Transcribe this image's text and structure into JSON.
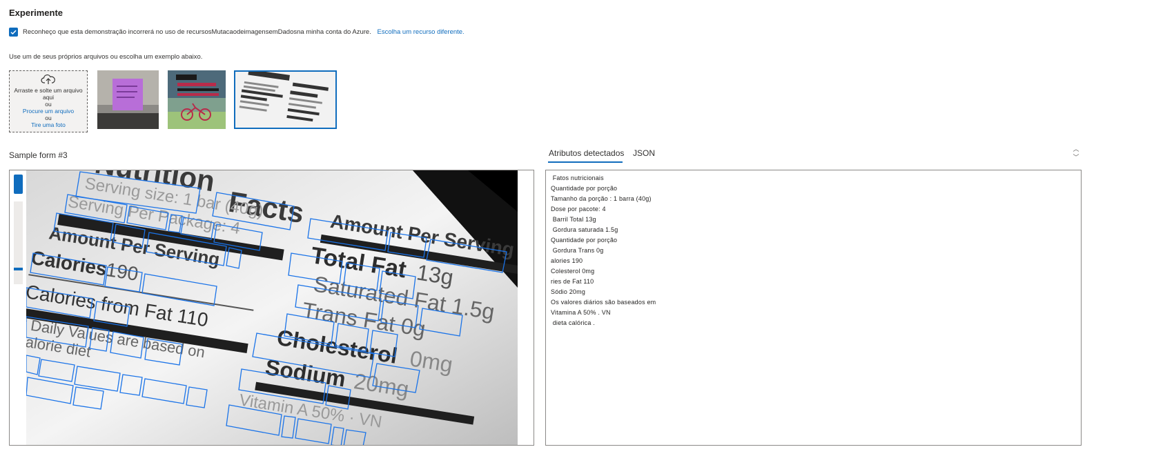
{
  "header": {
    "title": "Experimente"
  },
  "consent": {
    "checked": true,
    "text": "Reconheço que esta demonstração incorrerá no uso de recursosMutacaodeimagensemDadosna minha conta do Azure.",
    "link": "Escolha um recurso diferente."
  },
  "instructions": "Use um de seus próprios arquivos ou escolha um exemplo abaixo.",
  "upload": {
    "line1": "Arraste e solte um arquivo",
    "line2": "aqui",
    "or1": "ou",
    "browse": "Procure um arquivo",
    "or2": "ou",
    "photo": "Tire uma foto",
    "icon": "cloud-upload-icon"
  },
  "samples": [
    {
      "name": "sticky-note"
    },
    {
      "name": "life-is-like-poster"
    },
    {
      "name": "nutrition-facts",
      "selected": true
    }
  ],
  "sample_label": "Sample form #3",
  "tabs": {
    "active": "Atributos detectados",
    "json": "JSON"
  },
  "results": [
    " Fatos nutricionais",
    "Quantidade por porção",
    "Tamanho da porção : 1 barra (40g)",
    "Dose por pacote: 4",
    " Barril Total 13g",
    " Gordura saturada 1.5g",
    "Quantidade por porção",
    " Gordura Trans 0g",
    "alories 190",
    "Colesterol 0mg",
    "ries de Fat 110",
    "Sódio 20mg",
    "Os valores diários são baseados em",
    "Vitamina A 50% . VN",
    " dieta calórica ."
  ],
  "colors": {
    "accent": "#0f6cbd",
    "box": "#1a73e8"
  }
}
